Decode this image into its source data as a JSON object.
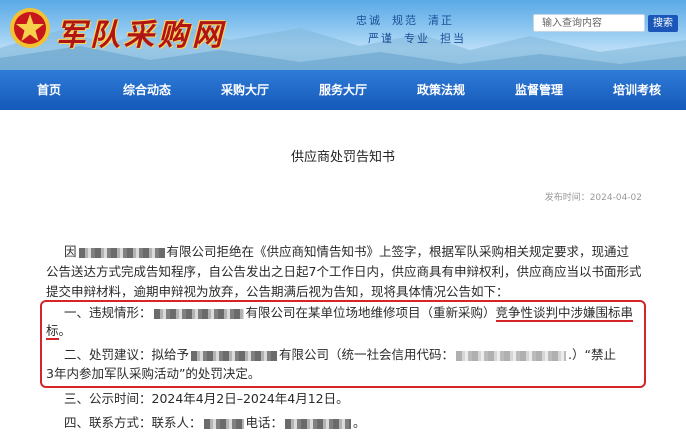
{
  "header": {
    "site_title": "军队采购网",
    "slogans": [
      "忠诚",
      "规范",
      "清正",
      "严谨",
      "专业",
      "担当"
    ],
    "search_placeholder": "输入查询内容",
    "search_button": "搜索"
  },
  "nav": {
    "items": [
      "首页",
      "综合动态",
      "采购大厅",
      "服务大厅",
      "政策法规",
      "监督管理",
      "培训考核"
    ]
  },
  "article": {
    "title": "供应商处罚告知书",
    "date": "发布时间：2024-04-02",
    "intro_prefix": "因",
    "intro_line1": "有限公司拒绝在《供应商知情告知书》上签字，根据军队采购相关规定要求，现通过",
    "intro_line2": "公告送达方式完成告知程序，自公告发出之日起7个工作日内，供应商具有申辩权利，供应商应当以书面形式",
    "intro_line3": "提交申辩材料，逾期申辩视为放弃，公告期满后视为告知，现将具体情况公告如下：",
    "item1_prefix": "一、违规情形：",
    "item1_mid": "有限公司在某单位场地维修项目（重新采购）",
    "item1_highlight": "竞争性谈判中涉嫌围标串",
    "item1_highlight_end": "标",
    "item1_end": "。",
    "item2_prefix": "二、处罚建议：拟给予",
    "item2_mid": "有限公司（统一社会信用代码：",
    "item2_end": ".）“禁止",
    "item2_line2": "3年内参加军队采购活动”的处罚决定。",
    "item3": "三、公示时间：2024年4月2日–2024年4月12日。",
    "item4_prefix": "四、联系方式：联系人：",
    "item4_phone": "电话：",
    "item4_end": "。"
  }
}
